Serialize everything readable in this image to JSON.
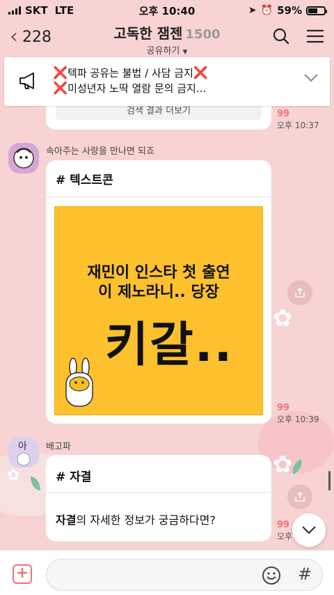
{
  "status_bar": {
    "carrier": "SKT",
    "network": "LTE",
    "time": "오후 10:40",
    "battery_percent": "59%",
    "battery_level": 0.59
  },
  "header": {
    "back_count": "228",
    "title": "고독한 잼젠",
    "member_count": "1500",
    "share_label": "공유하기"
  },
  "notice": {
    "line1": "텍파 공유는 불법 / 사담 금지",
    "line2": "미성년자 노딱 열람 문의 금지...",
    "mark": "❌"
  },
  "messages": [
    {
      "type": "previous",
      "snippet": "검색 결과 더보기",
      "unread": "99",
      "time": "오후 10:37"
    },
    {
      "type": "card",
      "sender": "속아주는 사랑을 만나면 되죠",
      "tag": "# 텍스트콘",
      "image_lines": [
        "재민이 인스타 첫 출연",
        "이 제노라니.. 당장",
        "키갈.."
      ],
      "unread": "99",
      "time": "오후 10:39"
    },
    {
      "type": "card",
      "sender": "배고파",
      "avatar_text": "아",
      "tag": "# 자결",
      "body_bold": "자결",
      "body_rest": "의 자세한 정보가 궁금하다면?",
      "unread": "99",
      "time": "오후 10:4"
    }
  ],
  "colors": {
    "background": "#f8d3d3",
    "accent": "#f0727a",
    "notice_x": "#e8322f",
    "image_yellow": "#fcc12d"
  },
  "icons": {
    "header": [
      "search-icon",
      "menu-icon"
    ],
    "notice": [
      "megaphone-icon",
      "chevron-down-icon"
    ],
    "input": [
      "plus-icon",
      "emoji-icon",
      "hash-icon"
    ]
  }
}
